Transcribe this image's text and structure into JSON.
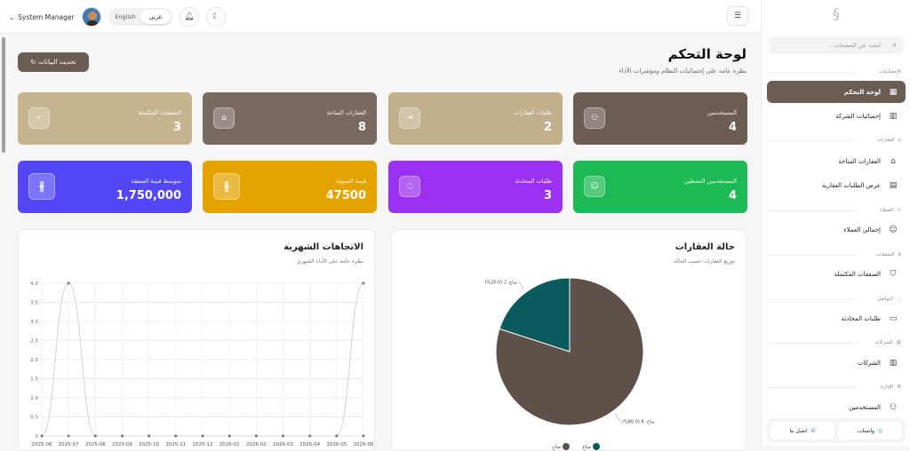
{
  "topbar": {
    "user_name": "System Manager",
    "lang_en": "English",
    "lang_ar": "عربي",
    "bell_icon": "bell-icon",
    "moon_icon": "moon-icon",
    "menu_icon": "menu-icon"
  },
  "page": {
    "title": "لوحة التحكم",
    "subtitle": "نظرة عامة على إحصائيات النظام ومؤشرات الأداء",
    "refresh_label": "تحديث البيانات"
  },
  "stats_row1": [
    {
      "label": "المستخدمين",
      "value": "4",
      "icon": "users-icon",
      "color": "#6b5d54"
    },
    {
      "label": "طلبات العقارات",
      "value": "2",
      "icon": "request-icon",
      "color": "#c2b08c"
    },
    {
      "label": "العقارات المتاحة",
      "value": "8",
      "icon": "home-icon",
      "color": "#786a60"
    },
    {
      "label": "الصفقات المكتملة",
      "value": "3",
      "icon": "check-icon",
      "color": "#c6b48f"
    }
  ],
  "stats_row2": [
    {
      "label": "المستخدمين النشطين",
      "value": "4",
      "icon": "user-check-icon",
      "color": "#1db954"
    },
    {
      "label": "طلبات المحادثة",
      "value": "3",
      "icon": "chat-icon",
      "color": "#9b30f0"
    },
    {
      "label": "قيمة العمولة",
      "value": "47500",
      "icon": "riyal-icon",
      "color": "#e5a300"
    },
    {
      "label": "متوسط قيمة الصفقة",
      "value": "1,750,000",
      "icon": "riyal-icon",
      "color": "#5346f4"
    }
  ],
  "trend_panel": {
    "title": "الاتجاهات الشهرية",
    "subtitle": "نظرة عامة على الأداء الشهري"
  },
  "status_panel": {
    "title": "حالة العقارات",
    "subtitle": "توزيع العقارات حسب الحالة",
    "legend": [
      "متاح",
      "مباع"
    ]
  },
  "chart_data": [
    {
      "type": "line",
      "title": "الاتجاهات الشهرية",
      "x": [
        "2025-06",
        "2025-07",
        "2025-08",
        "2025-09",
        "2025-10",
        "2025-11",
        "2025-12",
        "2026-01",
        "2026-02",
        "2026-03",
        "2026-04",
        "2026-05",
        "2026-06"
      ],
      "series": [
        {
          "values": [
            0,
            4,
            0,
            0,
            0,
            0,
            0,
            0,
            0,
            0,
            0,
            0,
            4
          ]
        },
        {
          "values": [
            0,
            0,
            0,
            0,
            0,
            0,
            0,
            0,
            0,
            0,
            0,
            0,
            0
          ]
        }
      ],
      "ylim": [
        0,
        4
      ],
      "yticks": [
        "0",
        "0.5",
        "1.0",
        "1.5",
        "2.0",
        "2.5",
        "3.0",
        "3.5",
        "4.0"
      ],
      "grid": true
    },
    {
      "type": "pie",
      "title": "حالة العقارات",
      "labels": [
        "متاح",
        "مباع"
      ],
      "values": [
        80.0,
        20.0
      ],
      "data_labels": [
        "متاح: 8 (80.0%)",
        "مباع: 2 (20.0%)"
      ],
      "colors": [
        "#5e5149",
        "#0a5a5e"
      ],
      "legend_position": "bottom"
    }
  ],
  "sidebar": {
    "search_placeholder": "ابحث عن الصفحات...",
    "sections": [
      {
        "title": "الإحصائيات",
        "items": [
          {
            "label": "لوحة التحكم",
            "active": true
          },
          {
            "label": "إحصائيات الشركة"
          }
        ]
      },
      {
        "title": "العقارات",
        "items": [
          {
            "label": "العقارات المتاحة"
          },
          {
            "label": "عرض الطلبات العقارية"
          }
        ]
      },
      {
        "title": "العملاء",
        "items": [
          {
            "label": "إجمالي العملاء"
          }
        ]
      },
      {
        "title": "الصفقات",
        "items": [
          {
            "label": "الصفقات المكتملة"
          }
        ]
      },
      {
        "title": "التواصل",
        "items": [
          {
            "label": "طلبات المحادثة"
          }
        ]
      },
      {
        "title": "الشركات",
        "items": [
          {
            "label": "الشركات"
          }
        ]
      },
      {
        "title": "الإدارة",
        "items": [
          {
            "label": "المستخدمين"
          }
        ]
      }
    ],
    "contact_label": "اتصل بنا",
    "whatsapp_label": "واتساب"
  }
}
